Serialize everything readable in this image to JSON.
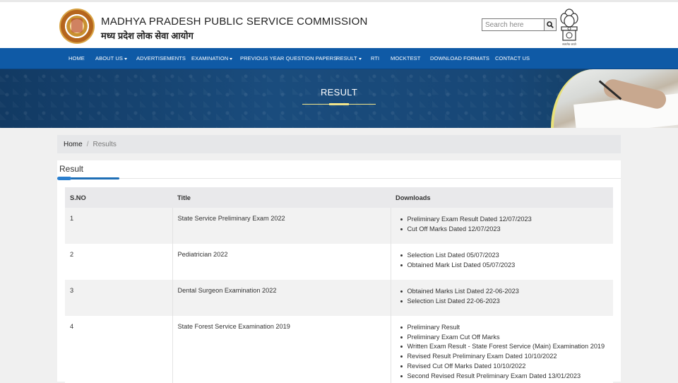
{
  "header": {
    "org_name_en": "MADHYA PRADESH PUBLIC SERVICE COMMISSION",
    "org_name_hi": "मध्य प्रदेश लोक सेवा आयोग",
    "search_placeholder": "Search here",
    "emblem_caption": "सत्यमेव जयते"
  },
  "nav": {
    "items": [
      {
        "label": "HOME",
        "dropdown": false
      },
      {
        "label": "ABOUT US",
        "dropdown": true
      },
      {
        "label": "ADVERTISEMENTS",
        "dropdown": false
      },
      {
        "label": "EXAMINATION",
        "dropdown": true
      },
      {
        "label": "PREVIOUS YEAR QUESTION PAPERS",
        "dropdown": false
      },
      {
        "label": "RESULT",
        "dropdown": true
      },
      {
        "label": "RTI",
        "dropdown": false
      },
      {
        "label": "MOCKTEST",
        "dropdown": false
      },
      {
        "label": "DOWNLOAD FORMATS",
        "dropdown": false
      },
      {
        "label": "CONTACT US",
        "dropdown": false
      }
    ]
  },
  "banner": {
    "title": "RESULT"
  },
  "breadcrumb": {
    "home": "Home",
    "separator": "/",
    "current": "Results"
  },
  "card": {
    "title": "Result"
  },
  "table": {
    "headers": [
      "S.NO",
      "Title",
      "Downloads"
    ],
    "rows": [
      {
        "sno": "1",
        "title": "State Service Preliminary Exam 2022",
        "downloads": [
          "Preliminary Exam Result Dated 12/07/2023",
          "Cut Off Marks Dated 12/07/2023"
        ]
      },
      {
        "sno": "2",
        "title": "Pediatrician 2022",
        "downloads": [
          "Selection List Dated 05/07/2023",
          "Obtained Mark List Dated 05/07/2023"
        ]
      },
      {
        "sno": "3",
        "title": "Dental Surgeon Examination 2022",
        "downloads": [
          "Obtained Marks List Dated 22-06-2023",
          "Selection List Dated 22-06-2023"
        ]
      },
      {
        "sno": "4",
        "title": "State Forest Service Examination 2019",
        "downloads": [
          "Preliminary Result",
          "Preliminary Exam Cut Off Marks",
          "Written Exam Result - State Forest Service (Main) Examination 2019",
          "Revised Result Preliminary Exam Dated 10/10/2022",
          "Revised Cut Off Marks Dated 10/10/2022",
          "Second Revised Result Preliminary Exam Dated 13/01/2023"
        ]
      }
    ]
  },
  "colors": {
    "nav_bg": "#0f5aa6",
    "banner_bg": "#1a4c7d",
    "accent": "#1f6fb6",
    "banner_line": "#f3e58a"
  }
}
